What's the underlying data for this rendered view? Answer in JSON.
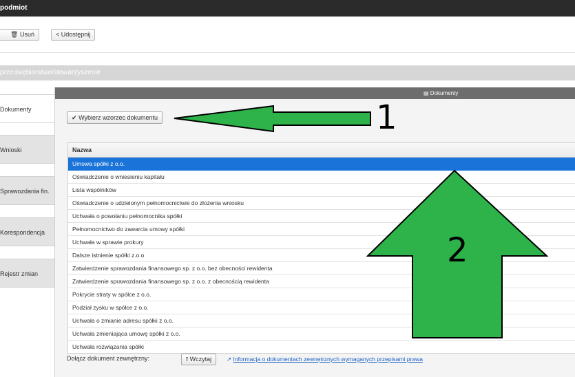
{
  "header": {
    "title": "podmiot"
  },
  "toolbar": {
    "delete_label": "Usuń",
    "share_label": "Udostępnij"
  },
  "section": {
    "title": "przedsiębiorstwo/stowarzyszenie"
  },
  "sidebar": {
    "items": [
      {
        "label": "Dokumenty"
      },
      {
        "label": "Wnioski"
      },
      {
        "label": "Sprawozdania fin."
      },
      {
        "label": "Korespondencja"
      },
      {
        "label": "Rejestr zmian"
      }
    ]
  },
  "panel": {
    "title": "Dokumenty",
    "pick_template_label": "Wybierz wzorzec dokumentu",
    "table": {
      "header": "Nazwa",
      "rows": [
        "Umowa spółki z o.o.",
        "Oświadczenie o wniesieniu kapitału",
        "Lista wspólników",
        "Oświadczenie o udzielonym pełnomocnictwie do złożenia wniosku",
        "Uchwała o powołaniu pełnomocnika spółki",
        "Pełnomocnictwo do zawarcia umowy spółki",
        "Uchwała w sprawie prokury",
        "Dalsze istnienie spółki z.o.o",
        "Zatwierdzenie sprawozdania finansowego sp. z o.o. bez obecności rewidenta",
        "Zatwierdzenie sprawozdania finansowego sp. z o.o. z obecnością rewidenta",
        "Pokrycie straty w spółce z o.o.",
        "Podział zysku w spółce z o.o.",
        "Uchwała o zmianie adresu spółki z o.o.",
        "Uchwała zmieniająca umowę spółki z o.o.",
        "Uchwała rozwiązania spółki"
      ],
      "selected_index": 0
    },
    "external_label": "Dołącz dokument zewnętrzny:",
    "load_label": "Wczytaj",
    "info_link": "Informacja o dokumentach zewnętrznych wymaganych przepisami prawa"
  },
  "annotations": {
    "label_1": "1",
    "label_2": "2",
    "arrow_color": "#2db34a"
  },
  "colors": {
    "selected_row": "#1a73d9",
    "topbar": "#2b2b2b",
    "panel_header": "#6d6d6d"
  }
}
